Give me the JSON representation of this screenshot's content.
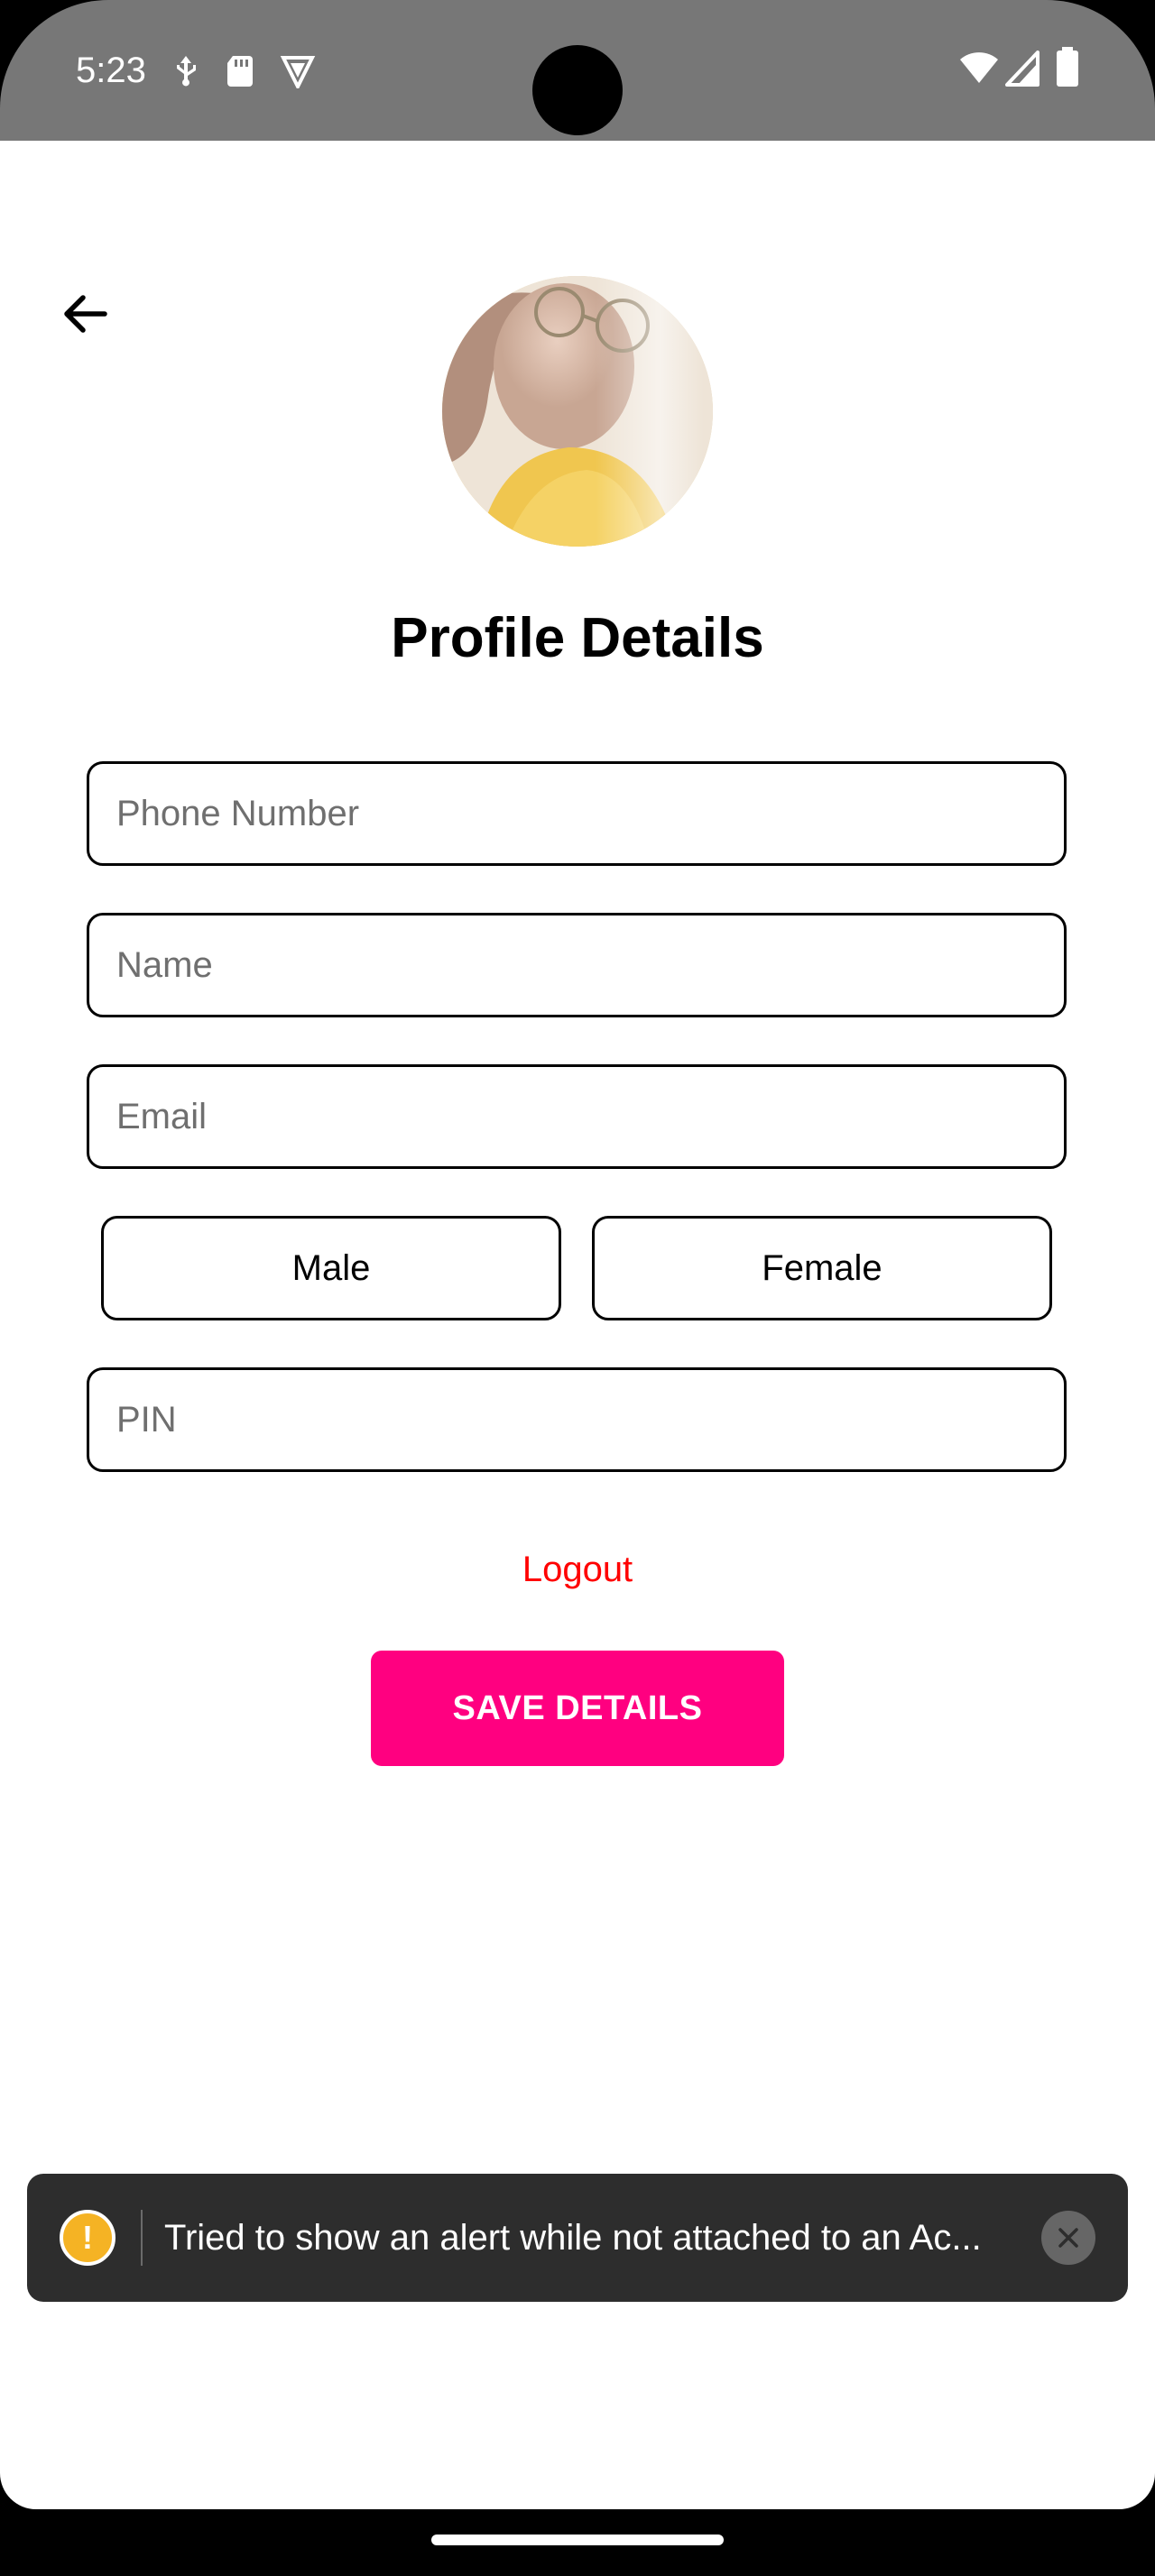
{
  "status_bar": {
    "time": "5:23",
    "left_icons": [
      "usb-debug-icon",
      "sd-card-icon",
      "vpn-shield-icon"
    ],
    "right_icons": [
      "wifi-icon",
      "cell-signal-icon",
      "battery-icon"
    ]
  },
  "header": {
    "back_icon": "arrow-left-icon",
    "title": "Profile Details"
  },
  "form": {
    "phone_placeholder": "Phone Number",
    "name_placeholder": "Name",
    "email_placeholder": "Email",
    "gender_options": [
      "Male",
      "Female"
    ],
    "pin_placeholder": "PIN"
  },
  "actions": {
    "logout_label": "Logout",
    "save_label": "SAVE DETAILS"
  },
  "toast": {
    "icon": "warning-icon",
    "message": "Tried to show an alert while not attached to an Ac...",
    "close_icon": "close-icon"
  },
  "colors": {
    "accent": "#ff0080",
    "logout": "#ff0000",
    "status_bar": "#777777",
    "toast_bg": "#2d2d2d",
    "warning": "#f5b324"
  }
}
